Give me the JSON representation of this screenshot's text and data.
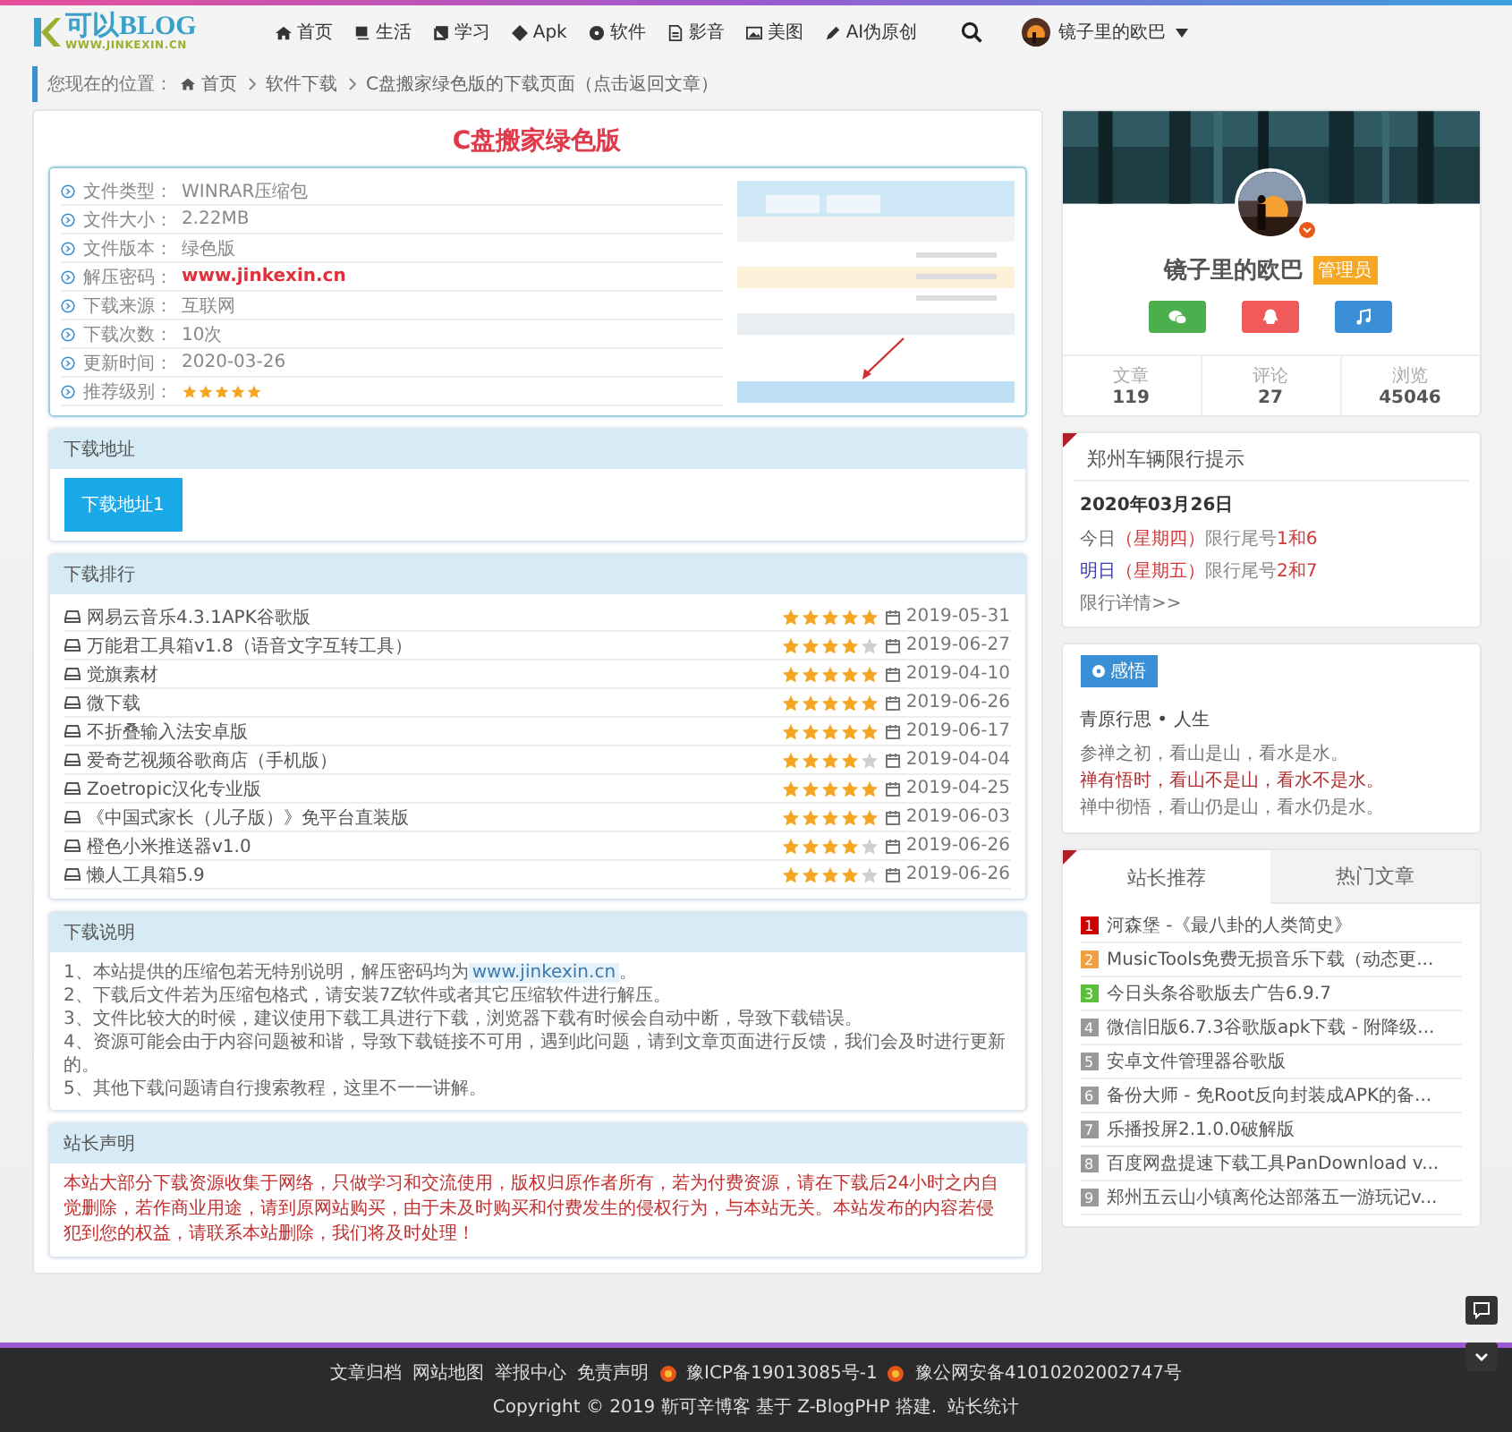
{
  "header": {
    "logo": {
      "title": "可以BLOG",
      "subtitle": "WWW.JINKEXIN.CN"
    },
    "nav": [
      {
        "label": "首页"
      },
      {
        "label": "生活"
      },
      {
        "label": "学习"
      },
      {
        "label": "Apk"
      },
      {
        "label": "软件"
      },
      {
        "label": "影音"
      },
      {
        "label": "美图"
      },
      {
        "label": "AI伪原创"
      }
    ],
    "user": {
      "name": "镜子里的欧巴"
    }
  },
  "breadcrumb": {
    "prefix": "您现在的位置：",
    "items": [
      "首页",
      "软件下载",
      "C盘搬家绿色版的下载页面（点击返回文章）"
    ]
  },
  "article": {
    "title": "C盘搬家绿色版",
    "info": [
      {
        "kind": "text",
        "label": "文件类型：",
        "value": "WINRAR压缩包"
      },
      {
        "kind": "text",
        "label": "文件大小：",
        "value": "2.22MB"
      },
      {
        "kind": "text",
        "label": "文件版本：",
        "value": "绿色版"
      },
      {
        "kind": "highlight",
        "label": "解压密码：",
        "value": "www.jinkexin.cn"
      },
      {
        "kind": "text",
        "label": "下载来源：",
        "value": "互联网"
      },
      {
        "kind": "text",
        "label": "下载次数：",
        "value": "10次"
      },
      {
        "kind": "text",
        "label": "更新时间：",
        "value": "2020-03-26"
      },
      {
        "kind": "stars",
        "label": "推荐级别：",
        "stars": 5
      }
    ]
  },
  "download": {
    "title": "下载地址",
    "buttons": [
      "下载地址1"
    ]
  },
  "ranking": {
    "title": "下载排行",
    "items": [
      {
        "name": "网易云音乐4.3.1APK谷歌版",
        "stars": 5,
        "date": "2019-05-31"
      },
      {
        "name": "万能君工具箱v1.8（语音文字互转工具）",
        "stars": 4,
        "date": "2019-06-27"
      },
      {
        "name": "觉旗素材",
        "stars": 5,
        "date": "2019-04-10"
      },
      {
        "name": "微下载",
        "stars": 5,
        "date": "2019-06-26"
      },
      {
        "name": "不折叠输入法安卓版",
        "stars": 5,
        "date": "2019-06-17"
      },
      {
        "name": "爱奇艺视频谷歌商店（手机版）",
        "stars": 4,
        "date": "2019-04-04"
      },
      {
        "name": "Zoetropic汉化专业版",
        "stars": 5,
        "date": "2019-04-25"
      },
      {
        "name": "《中国式家长（儿子版）》免平台直装版",
        "stars": 5,
        "date": "2019-06-03"
      },
      {
        "name": "橙色小米推送器v1.0",
        "stars": 4,
        "date": "2019-06-26"
      },
      {
        "name": "懒人工具箱5.9",
        "stars": 4,
        "date": "2019-06-26"
      }
    ]
  },
  "notes": {
    "title": "下载说明",
    "lines": [
      {
        "text": "1、本站提供的压缩包若无特别说明，解压密码均为",
        "link": "www.jinkexin.cn",
        "tail": "。"
      },
      {
        "text": "2、下载后文件若为压缩包格式，请安装7Z软件或者其它压缩软件进行解压。"
      },
      {
        "text": "3、文件比较大的时候，建议使用下载工具进行下载，浏览器下载有时候会自动中断，导致下载错误。"
      },
      {
        "text": "4、资源可能会由于内容问题被和谐，导致下载链接不可用，遇到此问题，请到文章页面进行反馈，我们会及时进行更新的。"
      },
      {
        "text": "5、其他下载问题请自行搜索教程，这里不一一讲解。"
      }
    ]
  },
  "statement": {
    "title": "站长声明",
    "text": "本站大部分下载资源收集于网络，只做学习和交流使用，版权归原作者所有，若为付费资源，请在下载后24小时之内自觉删除，若作商业用途，请到原网站购买，由于未及时购买和付费发生的侵权行为，与本站无关。本站发布的内容若侵犯到您的权益，请联系本站删除，我们将及时处理！"
  },
  "profile": {
    "name": "镜子里的欧巴",
    "badge": "管理员",
    "stats": [
      {
        "label": "文章",
        "value": "119"
      },
      {
        "label": "评论",
        "value": "27"
      },
      {
        "label": "浏览",
        "value": "45046"
      }
    ]
  },
  "traffic": {
    "title": "郑州车辆限行提示",
    "date": "2020年03月26日",
    "days": [
      {
        "day": "今日",
        "color": "#666666",
        "weekday": "（星期四）",
        "text": "限行尾号",
        "plates": "1和6"
      },
      {
        "day": "明日",
        "color": "#3b3bb0",
        "weekday": "（星期五）",
        "text": "限行尾号",
        "plates": "2和7"
      }
    ],
    "more": "限行详情>>"
  },
  "thoughts": {
    "badge": "感悟",
    "title": "青原行思 • 人生",
    "lines": [
      {
        "text": "参禅之初，看山是山，看水是水。",
        "highlight": false
      },
      {
        "text": "禅有悟时，看山不是山，看水不是水。",
        "highlight": true
      },
      {
        "text": "禅中彻悟，看山仍是山，看水仍是水。",
        "highlight": false
      }
    ]
  },
  "tabs": [
    {
      "label": "站长推荐",
      "selected": true
    },
    {
      "label": "热门文章",
      "selected": false
    }
  ],
  "posts": [
    {
      "rank": "1",
      "color": "#cc0000",
      "title": "河森堡 -《最八卦的人类简史》"
    },
    {
      "rank": "2",
      "color": "#f0a040",
      "title": "MusicTools免费无损音乐下载（动态更..."
    },
    {
      "rank": "3",
      "color": "#5cbf3a",
      "title": "今日头条谷歌版去广告6.9.7"
    },
    {
      "rank": "4",
      "color": "#999999",
      "title": "微信旧版6.7.3谷歌版apk下载 - 附降级..."
    },
    {
      "rank": "5",
      "color": "#999999",
      "title": "安卓文件管理器谷歌版"
    },
    {
      "rank": "6",
      "color": "#999999",
      "title": "备份大师 - 免Root反向封装成APK的备..."
    },
    {
      "rank": "7",
      "color": "#999999",
      "title": "乐播投屏2.1.0.0破解版"
    },
    {
      "rank": "8",
      "color": "#999999",
      "title": "百度网盘提速下载工具PanDownload v..."
    },
    {
      "rank": "9",
      "color": "#999999",
      "title": "郑州五云山小镇离伦达部落五一游玩记v..."
    }
  ],
  "footer": {
    "links": [
      "文章归档",
      "网站地图",
      "举报中心",
      "免责声明"
    ],
    "records": [
      "豫ICP备19013085号-1",
      "豫公网安备41010202002747号"
    ],
    "copyright": "Copyright © 2019 靳可辛博客 基于 Z-BlogPHP 搭建.",
    "stats_link": "站长统计"
  }
}
